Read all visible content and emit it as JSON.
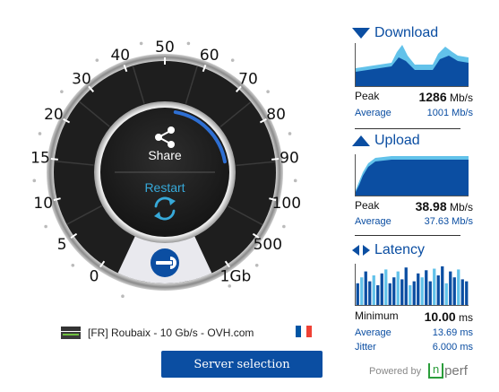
{
  "gauge": {
    "scale_labels": [
      "0",
      "5",
      "10",
      "15",
      "20",
      "30",
      "40",
      "50",
      "60",
      "70",
      "80",
      "90",
      "100",
      "500",
      "1Gb"
    ],
    "share_label": "Share",
    "restart_label": "Restart",
    "progress_fraction": 0.35
  },
  "server": {
    "name": "[FR] Roubaix - 10 Gb/s - OVH.com",
    "flag_colors": [
      "#0055a4",
      "#ffffff",
      "#ef4135"
    ],
    "selection_button": "Server selection"
  },
  "download": {
    "title": "Download",
    "peak_label": "Peak",
    "peak_value": "1286",
    "peak_unit": "Mb/s",
    "average_label": "Average",
    "average_value": "1001 Mb/s"
  },
  "upload": {
    "title": "Upload",
    "peak_label": "Peak",
    "peak_value": "38.98",
    "peak_unit": "Mb/s",
    "average_label": "Average",
    "average_value": "37.63 Mb/s"
  },
  "latency": {
    "title": "Latency",
    "min_label": "Minimum",
    "min_value": "10.00",
    "min_unit": "ms",
    "average_label": "Average",
    "average_value": "13.69 ms",
    "jitter_label": "Jitter",
    "jitter_value": "6.000 ms",
    "bars": [
      0.55,
      0.7,
      0.85,
      0.6,
      0.75,
      0.5,
      0.8,
      0.9,
      0.55,
      0.7,
      0.85,
      0.65,
      0.95,
      0.5,
      0.6,
      0.8,
      0.7,
      0.88,
      0.6,
      0.92,
      0.75,
      0.98,
      0.55,
      0.85,
      0.7,
      0.9,
      0.65,
      0.6
    ]
  },
  "colors": {
    "brand_blue": "#0b4ea2",
    "accent_light_blue": "#37a9d9",
    "chart_light": "#62c2ea",
    "gauge_dark": "#232323"
  },
  "footer": {
    "powered_by": "Powered by",
    "logo_text": "perf"
  }
}
